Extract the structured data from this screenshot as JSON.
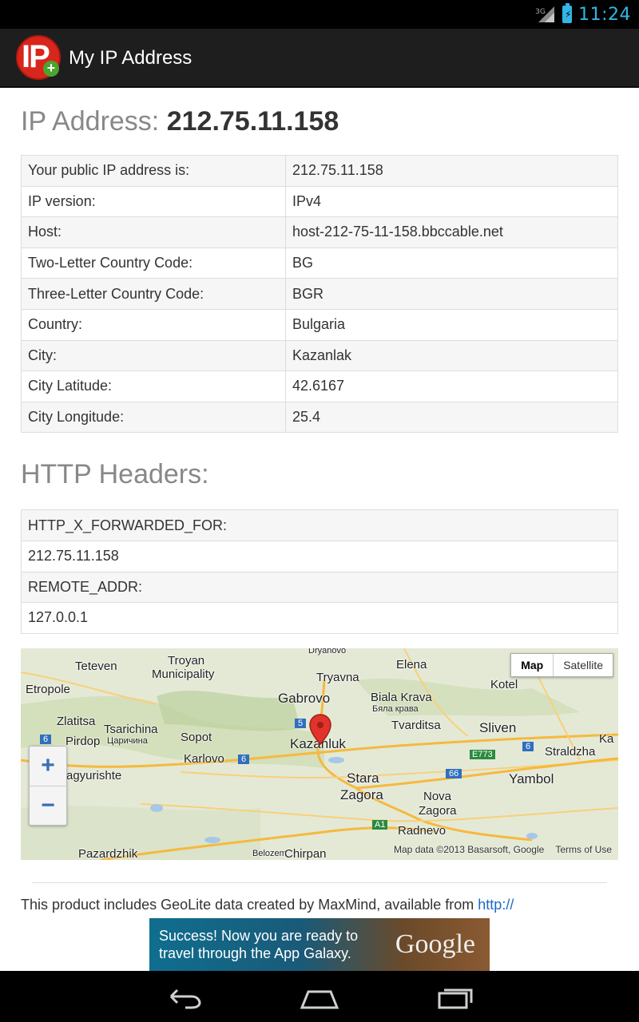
{
  "status_bar": {
    "network": "3G",
    "time": "11:24",
    "accent_color": "#33b5e5",
    "icons": [
      "signal-icon",
      "battery-charging-icon"
    ]
  },
  "action_bar": {
    "app_icon_text": "IP",
    "title": "My IP Address"
  },
  "ip_heading": {
    "label": "IP Address:",
    "value": "212.75.11.158"
  },
  "info_table": [
    {
      "key": "Your public IP address is:",
      "value": "212.75.11.158"
    },
    {
      "key": "IP version:",
      "value": "IPv4"
    },
    {
      "key": "Host:",
      "value": "host-212-75-11-158.bbccable.net"
    },
    {
      "key": "Two-Letter Country Code:",
      "value": "BG"
    },
    {
      "key": "Three-Letter Country Code:",
      "value": "BGR"
    },
    {
      "key": "Country:",
      "value": "Bulgaria"
    },
    {
      "key": "City:",
      "value": "Kazanlak"
    },
    {
      "key": "City Latitude:",
      "value": "42.6167"
    },
    {
      "key": "City Longitude:",
      "value": "25.4"
    }
  ],
  "headers_heading": "HTTP Headers:",
  "headers_table": [
    "HTTP_X_FORWARDED_FOR:",
    "212.75.11.158",
    "REMOTE_ADDR:",
    "127.0.0.1"
  ],
  "map": {
    "type_options": [
      "Map",
      "Satellite"
    ],
    "selected_type": "Map",
    "zoom_in": "+",
    "zoom_out": "−",
    "attribution": "Map data ©2013 Basarsoft, Google",
    "terms": "Terms of Use",
    "labels": {
      "dryanovo": "Dryanovo",
      "teteven": "Teteven",
      "troyan": "Troyan",
      "municipality": "Municipality",
      "elena": "Elena",
      "kotel": "Kotel",
      "etropole": "Etropole",
      "tryavna": "Tryavna",
      "gabrovo": "Gabrovo",
      "biala_krava": "Biala Krava",
      "biala_krava_cyr": "Бяла крава",
      "zlatitsa": "Zlatitsa",
      "tsarichina": "Tsarichina",
      "tsarichina_cyr": "Царичина",
      "sopot": "Sopot",
      "tvarditsa": "Tvarditsa",
      "sliven": "Sliven",
      "pirdop": "Pirdop",
      "karlovo": "Karlovo",
      "kazanluk": "Kazanluk",
      "straldzha": "Straldzha",
      "panagyurishte": "agyurishte",
      "stara": "Stara",
      "zagora": "Zagora",
      "nova": "Nova",
      "nova_zagora": "Zagora",
      "yambol": "Yambol",
      "radnevo": "Radnevo",
      "pazardzhik": "Pazardzhik",
      "belozem": "Belozem",
      "chirpan": "Chirpan",
      "e773": "E773",
      "r66": "66",
      "r6a": "6",
      "r6b": "6",
      "r6c": "6",
      "r5": "5",
      "a1": "A1",
      "ka": "Ka"
    }
  },
  "footer": {
    "text": "This product includes GeoLite data created by MaxMind, available from ",
    "link": "http://"
  },
  "ad": {
    "line1": "Success! Now you are ready to",
    "line2": "travel through the App Galaxy.",
    "brand": "Google"
  },
  "nav_bar": {
    "buttons": [
      "back-icon",
      "home-icon",
      "recent-apps-icon"
    ]
  }
}
